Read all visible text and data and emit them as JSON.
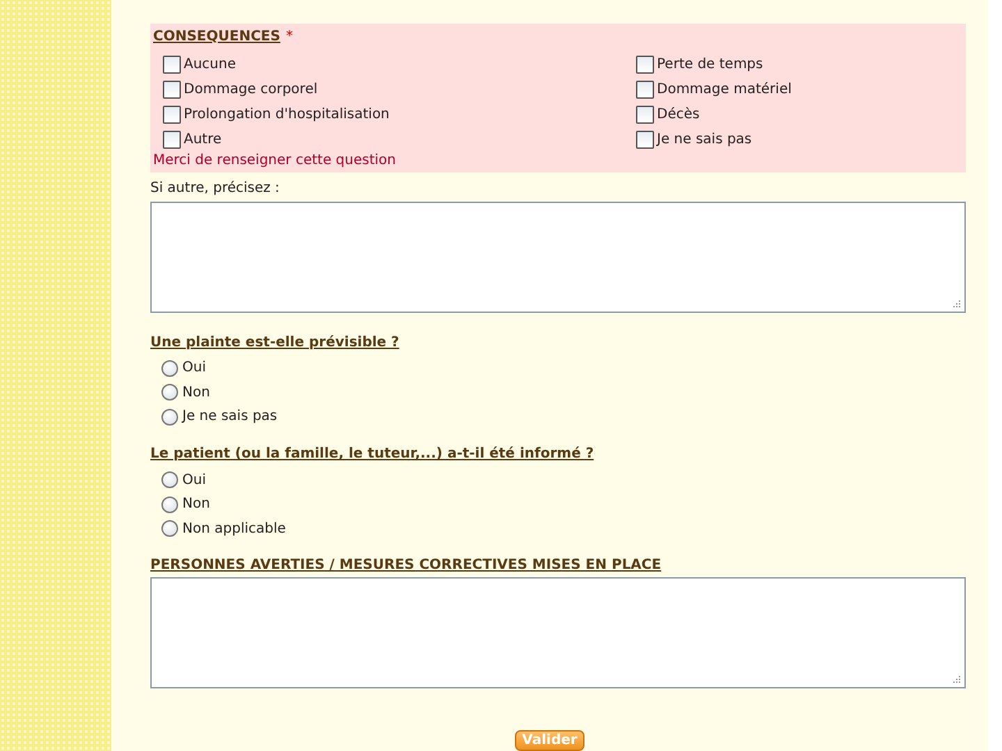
{
  "consequences": {
    "title": "CONSEQUENCES",
    "required_mark": "*",
    "error": "Merci de renseigner cette question",
    "columns": [
      [
        {
          "label": "Aucune",
          "checked": false
        },
        {
          "label": "Dommage corporel",
          "checked": false
        },
        {
          "label": "Prolongation d'hospitalisation",
          "checked": false
        },
        {
          "label": "Autre",
          "checked": false
        }
      ],
      [
        {
          "label": "Perte de temps",
          "checked": false
        },
        {
          "label": "Dommage matériel",
          "checked": false
        },
        {
          "label": "Décès",
          "checked": false
        },
        {
          "label": "Je ne sais pas",
          "checked": false
        }
      ]
    ]
  },
  "other": {
    "label": "Si autre, précisez :"
  },
  "questions": [
    {
      "title": "Une plainte est-elle prévisible ?",
      "options": [
        {
          "label": "Oui",
          "selected": false
        },
        {
          "label": "Non",
          "selected": false
        },
        {
          "label": "Je ne sais pas",
          "selected": false
        }
      ]
    },
    {
      "title": "Le patient (ou la famille, le tuteur,...) a-t-il été informé ?",
      "options": [
        {
          "label": "Oui",
          "selected": false
        },
        {
          "label": "Non",
          "selected": false
        },
        {
          "label": "Non applicable",
          "selected": false
        }
      ]
    }
  ],
  "measures": {
    "title": "PERSONNES AVERTIES / MESURES CORRECTIVES MISES EN PLACE"
  },
  "submit": "Valider"
}
